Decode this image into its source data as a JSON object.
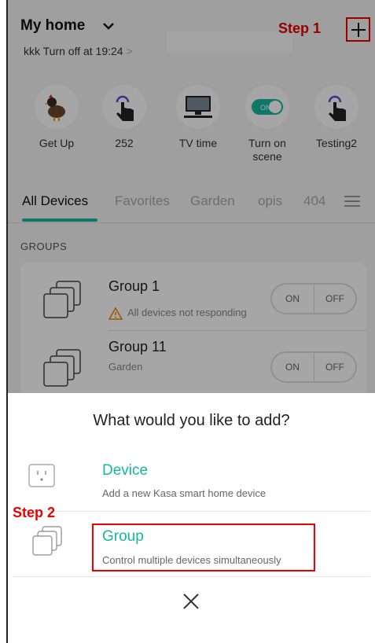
{
  "header": {
    "home_title": "My home",
    "schedule_text": "kkk Turn off at 19:24",
    "schedule_arrow": ">",
    "step1_label": "Step 1"
  },
  "scenes": [
    {
      "label": "Get Up",
      "icon": "chicken-icon"
    },
    {
      "label": "252",
      "icon": "tap-hand-icon"
    },
    {
      "label": "TV time",
      "icon": "tv-icon"
    },
    {
      "label": "Turn on scene",
      "icon": "toggle-on-icon"
    },
    {
      "label": "Testing2",
      "icon": "tap-hand-icon"
    }
  ],
  "toggle_icon_text": "ON",
  "tabs": [
    {
      "label": "All Devices",
      "active": true
    },
    {
      "label": "Favorites"
    },
    {
      "label": "Garden"
    },
    {
      "label": "opis"
    },
    {
      "label": "404"
    }
  ],
  "groups_header": "GROUPS",
  "groups": [
    {
      "name": "Group 1",
      "subtitle": "All devices not responding",
      "on": "ON",
      "off": "OFF"
    },
    {
      "name": "Group 11",
      "subtitle": "Garden",
      "on": "ON",
      "off": "OFF"
    }
  ],
  "sheet": {
    "title": "What would you like to add?",
    "options": [
      {
        "label": "Device",
        "desc": "Add a new Kasa smart home device"
      },
      {
        "label": "Group",
        "desc": "Control multiple devices simultaneously"
      }
    ],
    "step2_label": "Step 2"
  },
  "colors": {
    "accent": "#14b8a0",
    "annotation": "#ee0000",
    "warning": "#f08a00"
  }
}
